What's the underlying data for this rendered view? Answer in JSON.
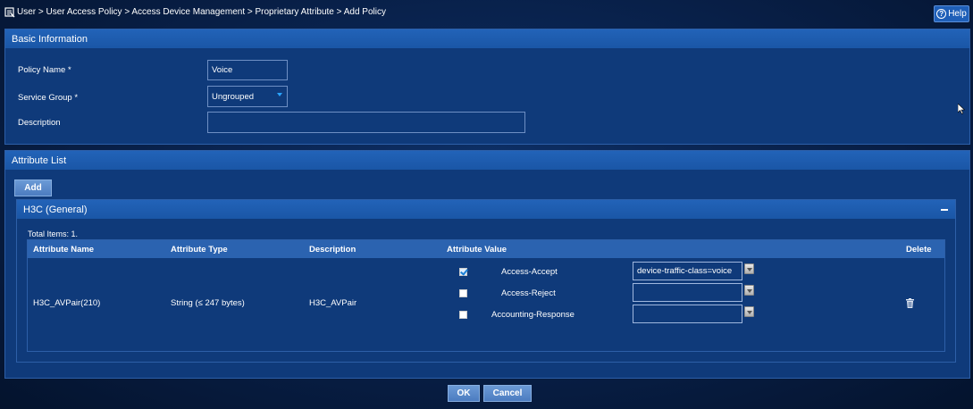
{
  "breadcrumb": "User > User Access Policy > Access Device Management > Proprietary Attribute > Add Policy",
  "help_label": "Help",
  "basic": {
    "title": "Basic Information",
    "policy_name_label": "Policy Name *",
    "policy_name_value": "Voice",
    "service_group_label": "Service Group *",
    "service_group_value": "Ungrouped",
    "description_label": "Description",
    "description_value": ""
  },
  "attr_list": {
    "title": "Attribute List",
    "add_label": "Add",
    "group_title": "H3C (General)",
    "total_items": "Total Items: 1.",
    "columns": [
      "Attribute Name",
      "Attribute Type",
      "Description",
      "Attribute Value",
      "Delete"
    ],
    "row": {
      "name": "H3C_AVPair(210)",
      "type": "String (≤ 247 bytes)",
      "description": "H3C_AVPair",
      "values": [
        {
          "label": "Access-Accept",
          "checked": true,
          "value": "device-traffic-class=voice"
        },
        {
          "label": "Access-Reject",
          "checked": false,
          "value": ""
        },
        {
          "label": "Accounting-Response",
          "checked": false,
          "value": ""
        }
      ]
    }
  },
  "footer": {
    "ok_label": "OK",
    "cancel_label": "Cancel"
  },
  "icons": {
    "breadcrumb": "location-icon",
    "help": "help-circle-icon",
    "collapse": "minus-icon",
    "delete": "trash-icon",
    "select": "chevron-down-icon"
  }
}
